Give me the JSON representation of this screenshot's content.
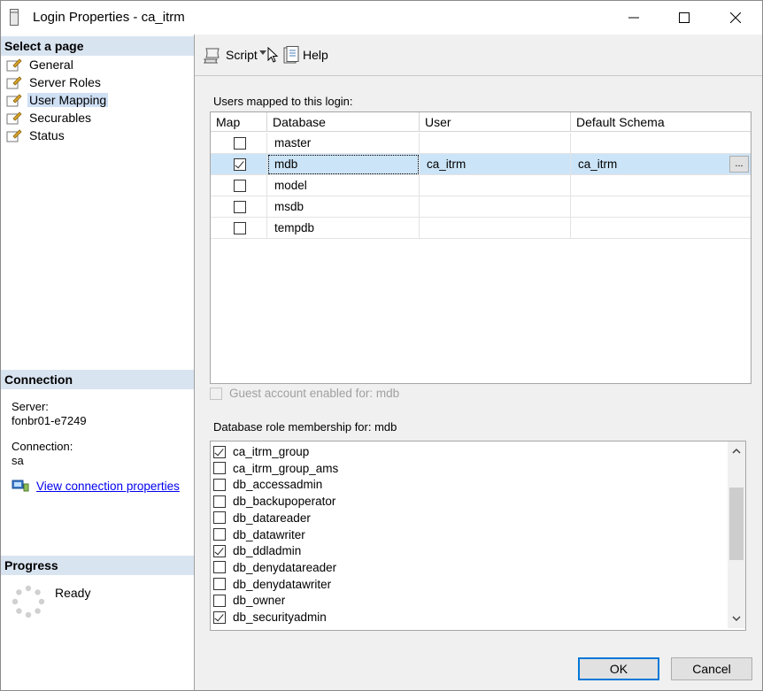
{
  "window": {
    "title": "Login Properties - ca_itrm"
  },
  "left": {
    "select_page": "Select a page",
    "pages": [
      {
        "label": "General",
        "selected": false
      },
      {
        "label": "Server Roles",
        "selected": false
      },
      {
        "label": "User Mapping",
        "selected": true
      },
      {
        "label": "Securables",
        "selected": false
      },
      {
        "label": "Status",
        "selected": false
      }
    ],
    "connection_header": "Connection",
    "server_label": "Server:",
    "server_value": "fonbr01-e7249",
    "connection_label": "Connection:",
    "connection_value": "sa",
    "view_link": "View connection properties",
    "progress_header": "Progress",
    "progress_status": "Ready"
  },
  "toolbar": {
    "script_label": "Script",
    "help_label": "Help"
  },
  "mapping": {
    "label": "Users mapped to this login:",
    "columns": [
      "Map",
      "Database",
      "User",
      "Default Schema"
    ],
    "rows": [
      {
        "checked": false,
        "database": "master",
        "user": "",
        "schema": ""
      },
      {
        "checked": true,
        "database": "mdb",
        "user": "ca_itrm",
        "schema": "ca_itrm"
      },
      {
        "checked": false,
        "database": "model",
        "user": "",
        "schema": ""
      },
      {
        "checked": false,
        "database": "msdb",
        "user": "",
        "schema": ""
      },
      {
        "checked": false,
        "database": "tempdb",
        "user": "",
        "schema": ""
      }
    ],
    "ellipsis": "..."
  },
  "guest": {
    "label": "Guest account enabled for: mdb",
    "checked": false
  },
  "roles": {
    "label": "Database role membership for: mdb",
    "items": [
      {
        "name": "ca_itrm_group",
        "checked": true
      },
      {
        "name": "ca_itrm_group_ams",
        "checked": false
      },
      {
        "name": "db_accessadmin",
        "checked": false
      },
      {
        "name": "db_backupoperator",
        "checked": false
      },
      {
        "name": "db_datareader",
        "checked": false
      },
      {
        "name": "db_datawriter",
        "checked": false
      },
      {
        "name": "db_ddladmin",
        "checked": true
      },
      {
        "name": "db_denydatareader",
        "checked": false
      },
      {
        "name": "db_denydatawriter",
        "checked": false
      },
      {
        "name": "db_owner",
        "checked": false
      },
      {
        "name": "db_securityadmin",
        "checked": true
      }
    ]
  },
  "footer": {
    "ok_label": "OK",
    "cancel_label": "Cancel"
  }
}
